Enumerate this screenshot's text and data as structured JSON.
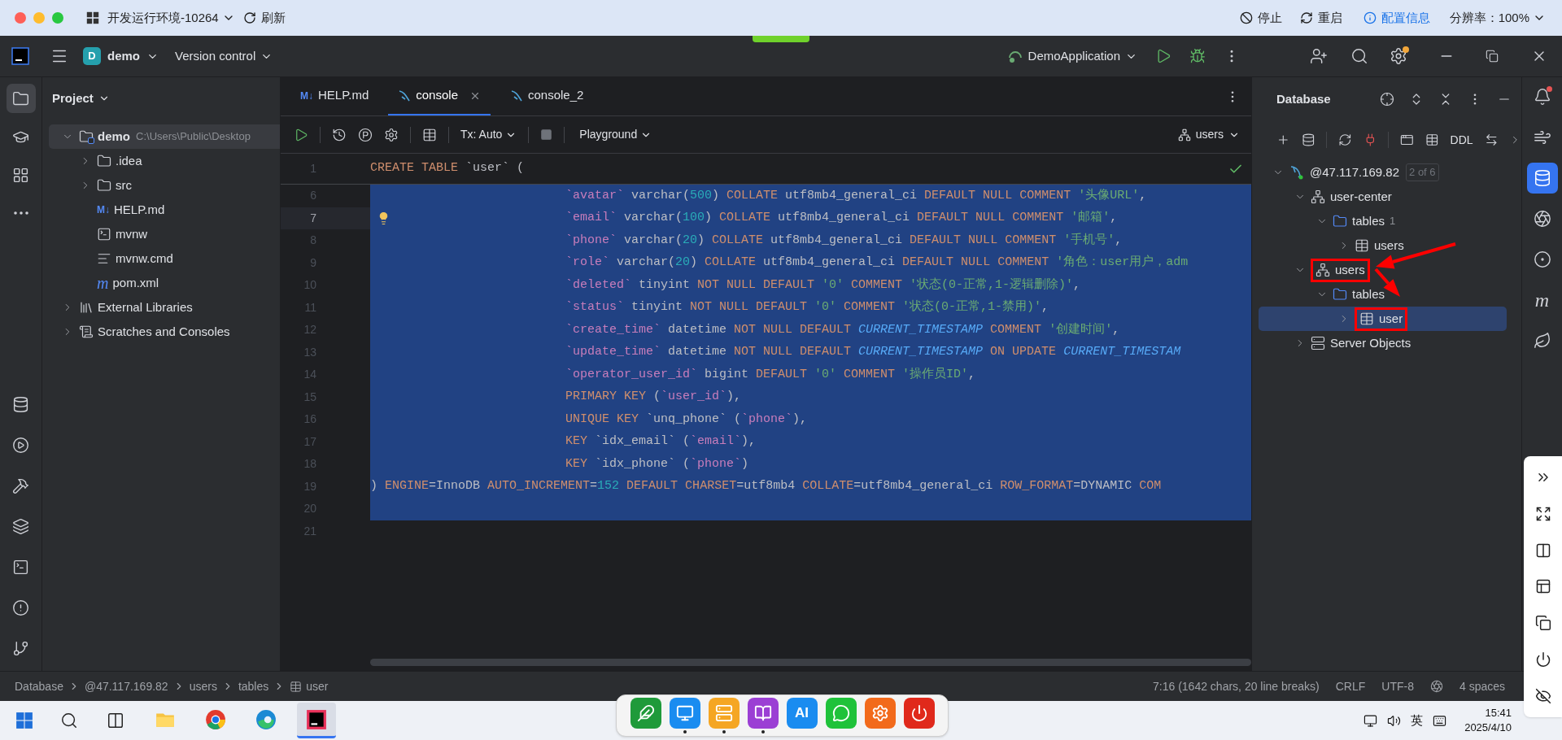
{
  "top_bar": {
    "env_title": "开发运行环境-10264",
    "refresh": "刷新",
    "stop": "停止",
    "restart": "重启",
    "config": "配置信息",
    "resolution": "分辨率：100%"
  },
  "title_bar": {
    "project_badge": "D",
    "project": "demo",
    "vcs": "Version control",
    "run_config": "DemoApplication",
    "settings_badge": true
  },
  "left_tools_top": [
    {
      "kind": "project",
      "selected": true
    },
    {
      "kind": "learn",
      "selected": false
    },
    {
      "kind": "structure",
      "selected": false
    },
    {
      "kind": "more",
      "selected": false
    }
  ],
  "left_tools_bottom": [
    {
      "kind": "database",
      "selected": false
    },
    {
      "kind": "services",
      "selected": false
    },
    {
      "kind": "build",
      "selected": false
    },
    {
      "kind": "datasource",
      "selected": false
    },
    {
      "kind": "terminal",
      "selected": false
    },
    {
      "kind": "problems",
      "selected": false
    },
    {
      "kind": "git",
      "selected": false
    }
  ],
  "project": {
    "title": "Project",
    "tree": [
      {
        "label": "demo",
        "path": "C:\\Users\\Public\\Desktop",
        "kind": "module",
        "expanded": true,
        "selected": true,
        "children": [
          {
            "label": ".idea",
            "kind": "folder",
            "expanded": false,
            "selected": false
          },
          {
            "label": "src",
            "kind": "folder",
            "expanded": false,
            "selected": false
          },
          {
            "label": "HELP.md",
            "kind": "markdown",
            "glyph": "M↓",
            "selected": false
          },
          {
            "label": "mvnw",
            "kind": "terminal",
            "selected": false
          },
          {
            "label": "mvnw.cmd",
            "kind": "text",
            "selected": false
          },
          {
            "label": "pom.xml",
            "kind": "maven",
            "glyph": "m",
            "selected": false
          }
        ]
      },
      {
        "label": "External Libraries",
        "kind": "library",
        "expanded": false,
        "selected": false
      },
      {
        "label": "Scratches and Consoles",
        "kind": "scratches",
        "expanded": false,
        "selected": false
      }
    ]
  },
  "editor": {
    "tabs": [
      {
        "label": "HELP.md",
        "kind": "markdown",
        "glyph": "M↓",
        "selected": false,
        "closable": false
      },
      {
        "label": "console",
        "kind": "console",
        "selected": true,
        "closable": true
      },
      {
        "label": "console_2",
        "kind": "console",
        "selected": false,
        "closable": false
      }
    ],
    "toolbar": {
      "tx": "Tx: Auto",
      "mode": "Playground",
      "schema": "users"
    },
    "lines": [
      {
        "number": "1",
        "kind": "sticky",
        "indented": false,
        "selected": false,
        "current": false,
        "tokens": [
          {
            "kind": "kw",
            "text": "CREATE TABLE"
          },
          {
            "kind": "plain",
            "text": " `user` ("
          }
        ]
      },
      {
        "number": "6",
        "kind": "code",
        "indented": true,
        "selected": true,
        "current": false,
        "tokens": [
          {
            "kind": "id",
            "text": "`avatar`"
          },
          {
            "kind": "plain",
            "text": " varchar("
          },
          {
            "kind": "num",
            "text": "500"
          },
          {
            "kind": "plain",
            "text": ") "
          },
          {
            "kind": "kw",
            "text": "COLLATE"
          },
          {
            "kind": "plain",
            "text": " utf8mb4_general_ci "
          },
          {
            "kind": "kw",
            "text": "DEFAULT NULL COMMENT "
          },
          {
            "kind": "str",
            "text": "'头像URL'"
          },
          {
            "kind": "plain",
            "text": ","
          }
        ]
      },
      {
        "number": "7",
        "kind": "code",
        "indented": true,
        "selected": true,
        "current": true,
        "tokens": [
          {
            "kind": "id",
            "text": "`email`"
          },
          {
            "kind": "plain",
            "text": " varchar("
          },
          {
            "kind": "num",
            "text": "100"
          },
          {
            "kind": "plain",
            "text": ") "
          },
          {
            "kind": "kw",
            "text": "COLLATE"
          },
          {
            "kind": "plain",
            "text": " utf8mb4_general_ci "
          },
          {
            "kind": "kw",
            "text": "DEFAULT NULL COMMENT "
          },
          {
            "kind": "str",
            "text": "'邮箱'"
          },
          {
            "kind": "plain",
            "text": ","
          }
        ]
      },
      {
        "number": "8",
        "kind": "code",
        "indented": true,
        "selected": true,
        "current": false,
        "tokens": [
          {
            "kind": "id",
            "text": "`phone`"
          },
          {
            "kind": "plain",
            "text": " varchar("
          },
          {
            "kind": "num",
            "text": "20"
          },
          {
            "kind": "plain",
            "text": ") "
          },
          {
            "kind": "kw",
            "text": "COLLATE"
          },
          {
            "kind": "plain",
            "text": " utf8mb4_general_ci "
          },
          {
            "kind": "kw",
            "text": "DEFAULT NULL COMMENT "
          },
          {
            "kind": "str",
            "text": "'手机号'"
          },
          {
            "kind": "plain",
            "text": ","
          }
        ]
      },
      {
        "number": "9",
        "kind": "code",
        "indented": true,
        "selected": true,
        "current": false,
        "tokens": [
          {
            "kind": "id",
            "text": "`role`"
          },
          {
            "kind": "plain",
            "text": " varchar("
          },
          {
            "kind": "num",
            "text": "20"
          },
          {
            "kind": "plain",
            "text": ") "
          },
          {
            "kind": "kw",
            "text": "COLLATE"
          },
          {
            "kind": "plain",
            "text": " utf8mb4_general_ci "
          },
          {
            "kind": "kw",
            "text": "DEFAULT NULL COMMENT "
          },
          {
            "kind": "str",
            "text": "'角色：user用户，adm"
          }
        ]
      },
      {
        "number": "10",
        "kind": "code",
        "indented": true,
        "selected": true,
        "current": false,
        "tokens": [
          {
            "kind": "id",
            "text": "`deleted`"
          },
          {
            "kind": "plain",
            "text": " tinyint "
          },
          {
            "kind": "kw",
            "text": "NOT NULL DEFAULT "
          },
          {
            "kind": "str",
            "text": "'0'"
          },
          {
            "kind": "kw",
            "text": " COMMENT "
          },
          {
            "kind": "str",
            "text": "'状态(0-正常,1-逻辑删除)'"
          },
          {
            "kind": "plain",
            "text": ","
          }
        ]
      },
      {
        "number": "11",
        "kind": "code",
        "indented": true,
        "selected": true,
        "current": false,
        "tokens": [
          {
            "kind": "id",
            "text": "`status`"
          },
          {
            "kind": "plain",
            "text": " tinyint "
          },
          {
            "kind": "kw",
            "text": "NOT NULL DEFAULT "
          },
          {
            "kind": "str",
            "text": "'0'"
          },
          {
            "kind": "kw",
            "text": " COMMENT "
          },
          {
            "kind": "str",
            "text": "'状态(0-正常,1-禁用)'"
          },
          {
            "kind": "plain",
            "text": ","
          }
        ]
      },
      {
        "number": "12",
        "kind": "code",
        "indented": true,
        "selected": true,
        "current": false,
        "tokens": [
          {
            "kind": "id",
            "text": "`create_time`"
          },
          {
            "kind": "plain",
            "text": " datetime "
          },
          {
            "kind": "kw",
            "text": "NOT NULL DEFAULT "
          },
          {
            "kind": "const",
            "text": "CURRENT_TIMESTAMP"
          },
          {
            "kind": "kw",
            "text": " COMMENT "
          },
          {
            "kind": "str",
            "text": "'创建时间'"
          },
          {
            "kind": "plain",
            "text": ","
          }
        ]
      },
      {
        "number": "13",
        "kind": "code",
        "indented": true,
        "selected": true,
        "current": false,
        "tokens": [
          {
            "kind": "id",
            "text": "`update_time`"
          },
          {
            "kind": "plain",
            "text": " datetime "
          },
          {
            "kind": "kw",
            "text": "NOT NULL DEFAULT "
          },
          {
            "kind": "const",
            "text": "CURRENT_TIMESTAMP"
          },
          {
            "kind": "kw",
            "text": " ON UPDATE "
          },
          {
            "kind": "const",
            "text": "CURRENT_TIMESTAM"
          }
        ]
      },
      {
        "number": "14",
        "kind": "code",
        "indented": true,
        "selected": true,
        "current": false,
        "tokens": [
          {
            "kind": "id",
            "text": "`operator_user_id`"
          },
          {
            "kind": "plain",
            "text": " bigint "
          },
          {
            "kind": "kw",
            "text": "DEFAULT "
          },
          {
            "kind": "str",
            "text": "'0'"
          },
          {
            "kind": "kw",
            "text": " COMMENT "
          },
          {
            "kind": "str",
            "text": "'操作员ID'"
          },
          {
            "kind": "plain",
            "text": ","
          }
        ]
      },
      {
        "number": "15",
        "kind": "code",
        "indented": true,
        "selected": true,
        "current": false,
        "tokens": [
          {
            "kind": "kw",
            "text": "PRIMARY KEY"
          },
          {
            "kind": "plain",
            "text": " ("
          },
          {
            "kind": "id",
            "text": "`user_id`"
          },
          {
            "kind": "plain",
            "text": "),"
          }
        ]
      },
      {
        "number": "16",
        "kind": "code",
        "indented": true,
        "selected": true,
        "current": false,
        "tokens": [
          {
            "kind": "kw",
            "text": "UNIQUE KEY"
          },
          {
            "kind": "plain",
            "text": " `unq_phone` ("
          },
          {
            "kind": "id",
            "text": "`phone`"
          },
          {
            "kind": "plain",
            "text": "),"
          }
        ]
      },
      {
        "number": "17",
        "kind": "code",
        "indented": true,
        "selected": true,
        "current": false,
        "tokens": [
          {
            "kind": "kw",
            "text": "KEY"
          },
          {
            "kind": "plain",
            "text": " `idx_email` ("
          },
          {
            "kind": "id",
            "text": "`email`"
          },
          {
            "kind": "plain",
            "text": "),"
          }
        ]
      },
      {
        "number": "18",
        "kind": "code",
        "indented": true,
        "selected": true,
        "current": false,
        "tokens": [
          {
            "kind": "kw",
            "text": "KEY"
          },
          {
            "kind": "plain",
            "text": " `idx_phone` ("
          },
          {
            "kind": "id",
            "text": "`phone`"
          },
          {
            "kind": "plain",
            "text": ")"
          }
        ]
      },
      {
        "number": "19",
        "kind": "code",
        "indented": false,
        "selected": true,
        "current": false,
        "tokens": [
          {
            "kind": "plain",
            "text": ") "
          },
          {
            "kind": "kw",
            "text": "ENGINE"
          },
          {
            "kind": "plain",
            "text": "=InnoDB "
          },
          {
            "kind": "kw",
            "text": "AUTO_INCREMENT"
          },
          {
            "kind": "plain",
            "text": "="
          },
          {
            "kind": "num",
            "text": "152"
          },
          {
            "kind": "kw",
            "text": " DEFAULT CHARSET"
          },
          {
            "kind": "plain",
            "text": "=utf8mb4 "
          },
          {
            "kind": "kw",
            "text": "COLLATE"
          },
          {
            "kind": "plain",
            "text": "=utf8mb4_general_ci "
          },
          {
            "kind": "kw",
            "text": "ROW_FORMAT"
          },
          {
            "kind": "plain",
            "text": "=DYNAMIC "
          },
          {
            "kind": "kw",
            "text": "COM"
          }
        ]
      },
      {
        "number": "20",
        "kind": "code",
        "selected": true,
        "current": false
      },
      {
        "number": "21",
        "kind": "code",
        "selected": false,
        "current": false
      }
    ]
  },
  "database": {
    "title": "Database",
    "ddl": "DDL",
    "tree": [
      {
        "label": "@47.117.169.82",
        "kind": "connection",
        "badge": "2 of 6",
        "expanded": true,
        "selected": false,
        "annotated": false,
        "children": [
          {
            "label": "user-center",
            "kind": "schema",
            "expanded": true,
            "selected": false,
            "annotated": false,
            "children": [
              {
                "label": "tables",
                "kind": "folder",
                "count": "1",
                "expanded": true,
                "selected": false,
                "annotated": false,
                "children": [
                  {
                    "label": "users",
                    "kind": "table",
                    "expanded": false,
                    "selected": false,
                    "annotated": false
                  }
                ]
              }
            ]
          },
          {
            "label": "users",
            "kind": "schema",
            "expanded": true,
            "selected": false,
            "annotated": true,
            "children": [
              {
                "label": "tables",
                "kind": "folder",
                "expanded": true,
                "selected": false,
                "annotated": false,
                "children": [
                  {
                    "label": "user",
                    "kind": "table",
                    "expanded": false,
                    "selected": true,
                    "annotated": true
                  }
                ]
              }
            ]
          },
          {
            "label": "Server Objects",
            "kind": "server",
            "expanded": false,
            "selected": false,
            "annotated": false
          }
        ]
      }
    ]
  },
  "right_tools": [
    {
      "kind": "notifications",
      "badge": true,
      "selected": false
    },
    {
      "kind": "ai",
      "selected": false
    },
    {
      "kind": "database",
      "selected": true
    },
    {
      "kind": "plugin",
      "selected": false
    },
    {
      "kind": "endpoints",
      "selected": false
    },
    {
      "kind": "maven",
      "glyph": "m",
      "selected": false
    },
    {
      "kind": "spring",
      "selected": false
    }
  ],
  "status_bar": {
    "breadcrumb": [
      {
        "kind": "text",
        "label": "Database"
      },
      {
        "kind": "text",
        "label": "@47.117.169.82"
      },
      {
        "kind": "text",
        "label": "users"
      },
      {
        "kind": "text",
        "label": "tables"
      },
      {
        "kind": "table",
        "label": "user"
      }
    ],
    "position": "7:16 (1642 chars, 20 line breaks)",
    "line_sep": "CRLF",
    "encoding": "UTF-8",
    "indent": "4 spaces"
  },
  "taskbar": {
    "apps": [
      {
        "kind": "explorer",
        "active": false
      },
      {
        "kind": "chrome",
        "active": false
      },
      {
        "kind": "edge",
        "active": false
      },
      {
        "kind": "intellij",
        "active": true
      }
    ],
    "dock": [
      {
        "kind": "feather",
        "color": "#1f9a3a",
        "running": false
      },
      {
        "kind": "monitor",
        "color": "#1a8cf0",
        "running": true
      },
      {
        "kind": "server",
        "color": "#f5a623",
        "running": true
      },
      {
        "kind": "book",
        "color": "#9b3fd4",
        "running": true
      },
      {
        "kind": "ai",
        "label": "AI",
        "color": "#1a8cf0",
        "running": false
      },
      {
        "kind": "chat",
        "color": "#1fc23a",
        "running": false
      },
      {
        "kind": "gear",
        "color": "#f26a1b",
        "running": false
      },
      {
        "kind": "power",
        "color": "#e0291b",
        "running": false
      }
    ],
    "ime": "英",
    "time": "15:41",
    "date": "2025/4/10"
  }
}
